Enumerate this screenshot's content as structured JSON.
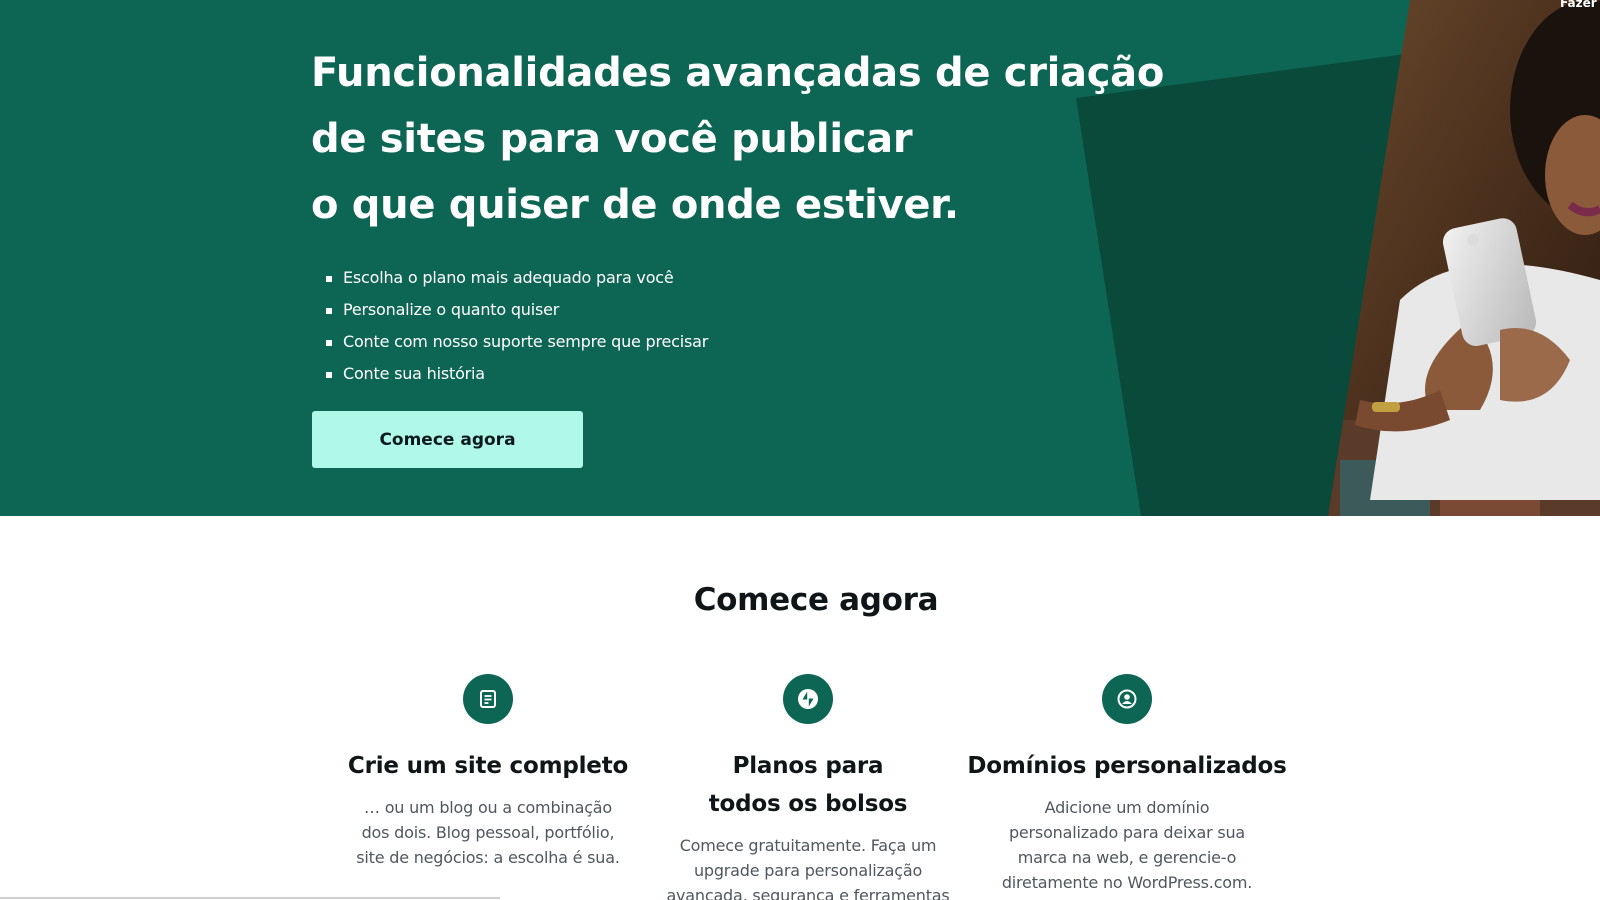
{
  "header": {
    "login_label": "Fazer login"
  },
  "hero": {
    "title_lines": [
      "Funcionalidades avançadas de criação",
      "de sites para você publicar",
      "o que quiser de onde estiver."
    ],
    "bullets": [
      "Escolha o plano mais adequado para você",
      "Personalize o quanto quiser",
      "Conte com nosso suporte sempre que precisar",
      "Conte sua história"
    ],
    "cta_label": "Comece agora"
  },
  "features_section": {
    "title": "Comece agora",
    "items": [
      {
        "icon": "page-icon",
        "title": "Crie um site completo",
        "text": "… ou um blog ou a combinação dos dois. Blog pessoal, portfólio, site de negócios: a escolha é sua."
      },
      {
        "icon": "jetpack-bolt-icon",
        "title": "Planos para todos os bolsos",
        "text": "Comece gratuitamente. Faça um upgrade para personalização avançada, segurança e ferramentas de SEO. Ou"
      },
      {
        "icon": "user-circle-icon",
        "title": "Domínios personalizados",
        "text": "Adicione um domínio personalizado para deixar sua marca na web, e gerencie-o diretamente no WordPress.com."
      }
    ]
  },
  "colors": {
    "hero_bg": "#0d6653",
    "hero_shape": "#0a4a3b",
    "cta_bg": "#b0f8e8",
    "icon_bg": "#0d6653",
    "heading": "#101517",
    "body_text": "#50575e"
  }
}
